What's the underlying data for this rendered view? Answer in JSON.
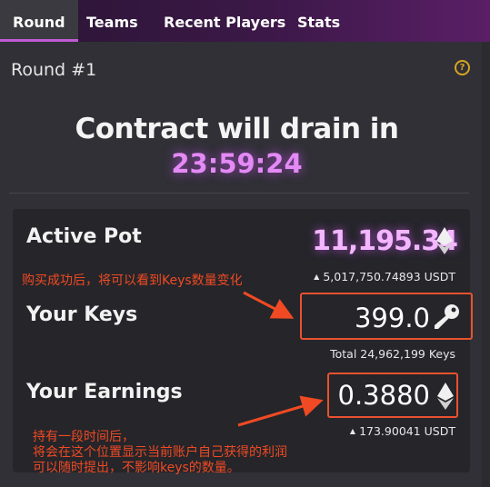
{
  "tabs": [
    {
      "label": "Round"
    },
    {
      "label": "Teams"
    },
    {
      "label": "Recent Players"
    },
    {
      "label": "Stats"
    }
  ],
  "round": {
    "title": "Round #1",
    "help_icon": "question-circle-icon",
    "drain_label": "Contract will drain in",
    "timer": "23:59:24"
  },
  "active_pot": {
    "label": "Active Pot",
    "value": "11,195.34",
    "currency_icon": "ethereum-icon",
    "sub_value": "5,017,750.74893 USDT"
  },
  "your_keys": {
    "label": "Your Keys",
    "value": "399.0",
    "icon": "key-icon",
    "sub_value": "Total 24,962,199 Keys"
  },
  "your_earnings": {
    "label": "Your Earnings",
    "value": "0.3880",
    "currency_icon": "ethereum-icon",
    "sub_value": "173.90041 USDT"
  },
  "annotations": {
    "keys_note": "购买成功后，将可以看到Keys数量变化",
    "earnings_note_line1": "持有一段时间后，",
    "earnings_note_line2": "将会在这个位置显示当前账户自己获得的利润",
    "earnings_note_line3": "可以随时提出，不影响keys的数量。"
  },
  "colors": {
    "accent": "#c15ad6",
    "timer": "#e48af5",
    "pot": "#f3b6ff",
    "annotation": "#ef4a23",
    "help": "#d8a422"
  }
}
